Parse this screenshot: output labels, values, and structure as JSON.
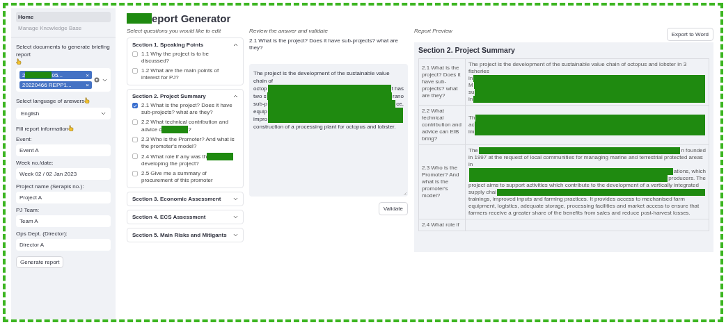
{
  "sidebar": {
    "nav": [
      {
        "label": "Home",
        "selected": true
      },
      {
        "label": "Manage Knowledge Base",
        "selected": false
      }
    ],
    "documents_label": "Select documents to generate briefing report",
    "documents": [
      {
        "start": "2",
        "redacted": true,
        "end": "05...",
        "remove": "×"
      },
      {
        "start": "20220466 REPP1...",
        "redacted": false,
        "remove": "×"
      }
    ],
    "language_label": "Select language of answers",
    "language": "English",
    "report_info_label": "Fill report information",
    "fields": [
      {
        "label": "Event:",
        "value": "Event A"
      },
      {
        "label": "Week no./date:",
        "value": "Week 02 / 02 Jan 2023"
      },
      {
        "label": "Project name (Serapis no.):",
        "value": "Project A"
      },
      {
        "label": "PJ Team:",
        "value": "Team A"
      },
      {
        "label": "Ops Dept. (Director):",
        "value": "Director A"
      }
    ],
    "generate_button": "Generate report"
  },
  "title": {
    "redacted": true,
    "end": "eport Generator"
  },
  "sections_column": {
    "heading": "Select questions you would like to edit",
    "sections": [
      {
        "title": "Section 1. Speaking Points",
        "expanded": true,
        "questions": [
          {
            "start": "1.1 Why the project is to be discussed?",
            "redacted": false,
            "checked": false
          },
          {
            "start": "1.2 What are the main points of interest for PJ?",
            "redacted": false,
            "checked": false
          }
        ]
      },
      {
        "title": "Section 2. Project Summary",
        "expanded": true,
        "questions": [
          {
            "start": "2.1 What is the project? Does it have sub-projects? what are they?",
            "redacted": false,
            "checked": true
          },
          {
            "start": "2.2 What technical contribution and advice c",
            "redacted": true,
            "end": "?",
            "checked": false
          },
          {
            "start": "2.3 Who is the Promoter? And what is the promoter's model?",
            "redacted": false,
            "checked": false
          },
          {
            "start": "2.4 What role if any was th",
            "redacted": true,
            "end": "developing the project?",
            "checked": false
          },
          {
            "start": "2.5 Give me a summary of procurement of this promoter",
            "redacted": false,
            "checked": false
          }
        ]
      },
      {
        "title": "Section 3. Economic Assessment",
        "expanded": false
      },
      {
        "title": "Section 4. ECS Assessment",
        "expanded": false
      },
      {
        "title": "Section 5. Main Risks and Mitigants",
        "expanded": false
      }
    ]
  },
  "review": {
    "heading": "Review the answer and validate",
    "question": "2.1 What is the project? Does it have sub-projects? what are they?",
    "answer_lines": [
      {
        "start": "The project is the development of the sustainable value chain of",
        "redacted": false
      },
      {
        "start": "octop",
        "redacted": true,
        "end": "t has"
      },
      {
        "start": "two s",
        "redacted": true,
        "end": "rano"
      },
      {
        "start": "sub-p",
        "redacted": true,
        "end": "ce,"
      },
      {
        "start": "equip",
        "redacted": true
      },
      {
        "start": "impro",
        "redacted": true
      },
      {
        "start": "construction of a processing plant for octopus and lobster.",
        "redacted": false
      }
    ],
    "validate_button": "Validate"
  },
  "preview": {
    "heading": "Report Preview",
    "export_button": "Export to Word",
    "section_title": "Section 2. Project Summary",
    "rows": [
      {
        "question": "2.1 What is the project? Does it have sub-projects? what are they?",
        "answer_lines": [
          {
            "start": "The project is the development of the sustainable value chain of octopus and lobster in 3 fisheries",
            "redacted": false
          },
          {
            "start": "in",
            "redacted": true
          },
          {
            "start": "M",
            "redacted": true
          },
          {
            "start": "su",
            "redacted": true
          },
          {
            "start": "in",
            "redacted": true
          }
        ]
      },
      {
        "question": "2.2 What technical contribution and advice can EIB bring?",
        "answer_lines": [
          {
            "start": "Th",
            "redacted": true
          },
          {
            "start": "ac",
            "redacted": true
          },
          {
            "start": "im",
            "redacted": true
          }
        ]
      },
      {
        "question": "2.3 Who is the Promoter? And what is the promoter's model?",
        "answer_lines": [
          {
            "start": "The",
            "redacted": true,
            "end": "n founded"
          },
          {
            "start": "in 1997 at the request of local communities for managing marine and terrestrial protected areas in",
            "redacted": false
          },
          {
            "redacted": true,
            "end": "ations, which"
          },
          {
            "redacted": true,
            "end": "producers. The"
          },
          {
            "start": "project aims to support activities which contribute to the development of a vertically integrated",
            "redacted": false
          },
          {
            "start": "supply chai",
            "redacted": true
          },
          {
            "start": "trainings, improved inputs and farming practices. It provides access to mechanised farm",
            "redacted": false
          },
          {
            "start": "equipment, logistics, adequate storage, processing facilities and market access to ensure that",
            "redacted": false
          },
          {
            "start": "farmers receive a greater share of the benefits from sales and reduce post-harvest losses.",
            "redacted": false
          }
        ]
      },
      {
        "question": "2.4 What role if"
      }
    ]
  }
}
